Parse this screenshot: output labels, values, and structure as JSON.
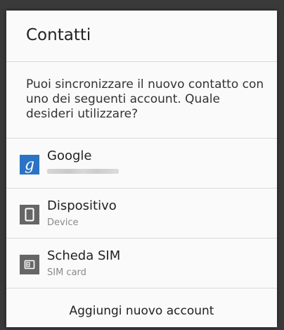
{
  "dialog": {
    "title": "Contatti",
    "message": "Puoi sincronizzare il nuovo contatto con uno dei seguenti account. Quale desideri utilizzare?",
    "accounts": [
      {
        "label": "Google",
        "subtitle": "",
        "icon": "google-icon"
      },
      {
        "label": "Dispositivo",
        "subtitle": "Device",
        "icon": "phone-device-icon"
      },
      {
        "label": "Scheda SIM",
        "subtitle": "SIM card",
        "icon": "sim-card-icon"
      }
    ],
    "add_account_label": "Aggiungi nuovo account"
  },
  "colors": {
    "background": "#3a3a3a",
    "dialog": "#fafafa",
    "google_icon": "#2a73c5",
    "gray_icon": "#666666"
  }
}
